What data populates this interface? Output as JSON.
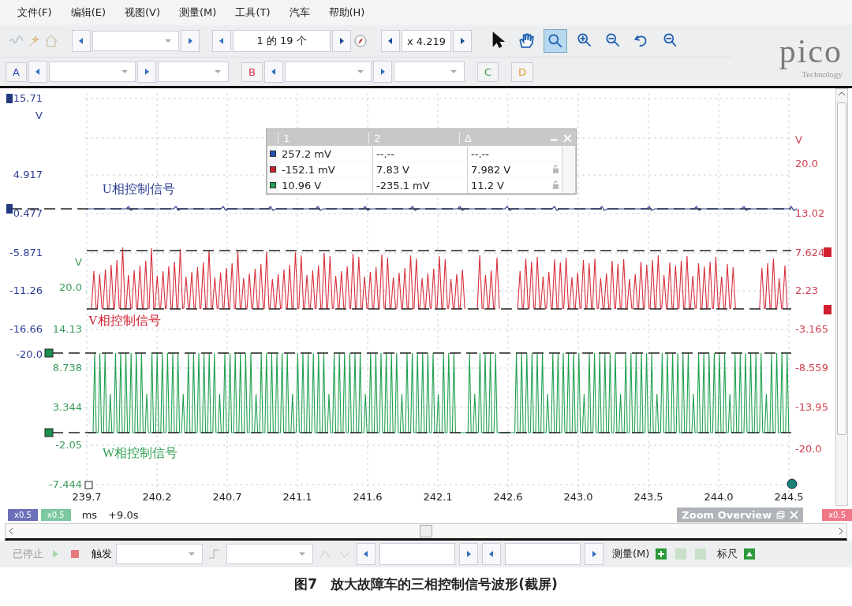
{
  "menu": [
    "文件(F)",
    "编辑(E)",
    "视图(V)",
    "测量(M)",
    "工具(T)",
    "汽车",
    "帮助(H)"
  ],
  "toolbar": {
    "page_counter": "1 的 19 个",
    "zoom_factor": "x 4.219",
    "tools": [
      {
        "kind": "pointer",
        "selected": false
      },
      {
        "kind": "hand",
        "selected": false
      },
      {
        "kind": "zoom-select",
        "selected": true
      },
      {
        "kind": "zoom-in",
        "selected": false
      },
      {
        "kind": "zoom-out",
        "selected": false
      },
      {
        "kind": "undo",
        "selected": false
      },
      {
        "kind": "zoom-fit",
        "selected": false
      }
    ]
  },
  "logo": {
    "name": "pico",
    "tagline": "Technology"
  },
  "channels": [
    {
      "label": "A",
      "color": "#3848c0",
      "kind": "full"
    },
    {
      "label": "B",
      "color": "#d03040",
      "kind": "full"
    },
    {
      "label": "C",
      "color": "#30a050",
      "kind": "compact"
    },
    {
      "label": "D",
      "color": "#e0a030",
      "kind": "compact"
    }
  ],
  "plot": {
    "left_axis": [
      "15.71",
      "V",
      "4.917",
      "0.477",
      "-5.871",
      "-11.26",
      "-16.66",
      "-20.0"
    ],
    "green_axis": [
      "V",
      "20.0",
      "14.13",
      "8.738",
      "3.344",
      "-2.05",
      "-7.444"
    ],
    "right_axis": [
      "V",
      "20.0",
      "13.02",
      "7.624",
      "2.23",
      "-3.165",
      "-8.559",
      "-13.95",
      "-20.0"
    ],
    "x_ticks": [
      "239.7",
      "240.2",
      "240.7",
      "241.1",
      "241.6",
      "242.1",
      "242.6",
      "243.0",
      "243.5",
      "244.0",
      "244.5"
    ],
    "signal_labels": [
      {
        "text": "U相控制信号",
        "color": "#2c3c90"
      },
      {
        "text": "V相控制信号",
        "color": "#d02030"
      },
      {
        "text": "W相控制信号",
        "color": "#30a050"
      }
    ]
  },
  "measurements": {
    "columns": [
      "1",
      "2",
      "Δ"
    ],
    "rows": [
      {
        "color": "#2050b0",
        "values": [
          "257.2 mV",
          "--.--",
          "--.--"
        ],
        "locked": false
      },
      {
        "color": "#d02030",
        "values": [
          "-152.1 mV",
          "7.83 V",
          "7.982 V"
        ],
        "locked": true
      },
      {
        "color": "#20a050",
        "values": [
          "10.96 V",
          "-235.1 mV",
          "11.2 V"
        ],
        "locked": true
      }
    ]
  },
  "scale_tags": [
    {
      "text": "x0.5",
      "color": "#6c70b8"
    },
    {
      "text": "x0.5",
      "color": "#7cc8a0"
    },
    {
      "text": "x0.5",
      "color": "#f07888"
    }
  ],
  "time_unit": "ms",
  "time_offset": "+9.0s",
  "zoom_overview": {
    "title": "Zoom Overview"
  },
  "bottom_bar": {
    "status": "已停止",
    "trigger": "触发",
    "measure": "测量(M)",
    "ruler": "标尺"
  },
  "caption": "图7　放大故障车的三相控制信号波形(截屏)"
}
